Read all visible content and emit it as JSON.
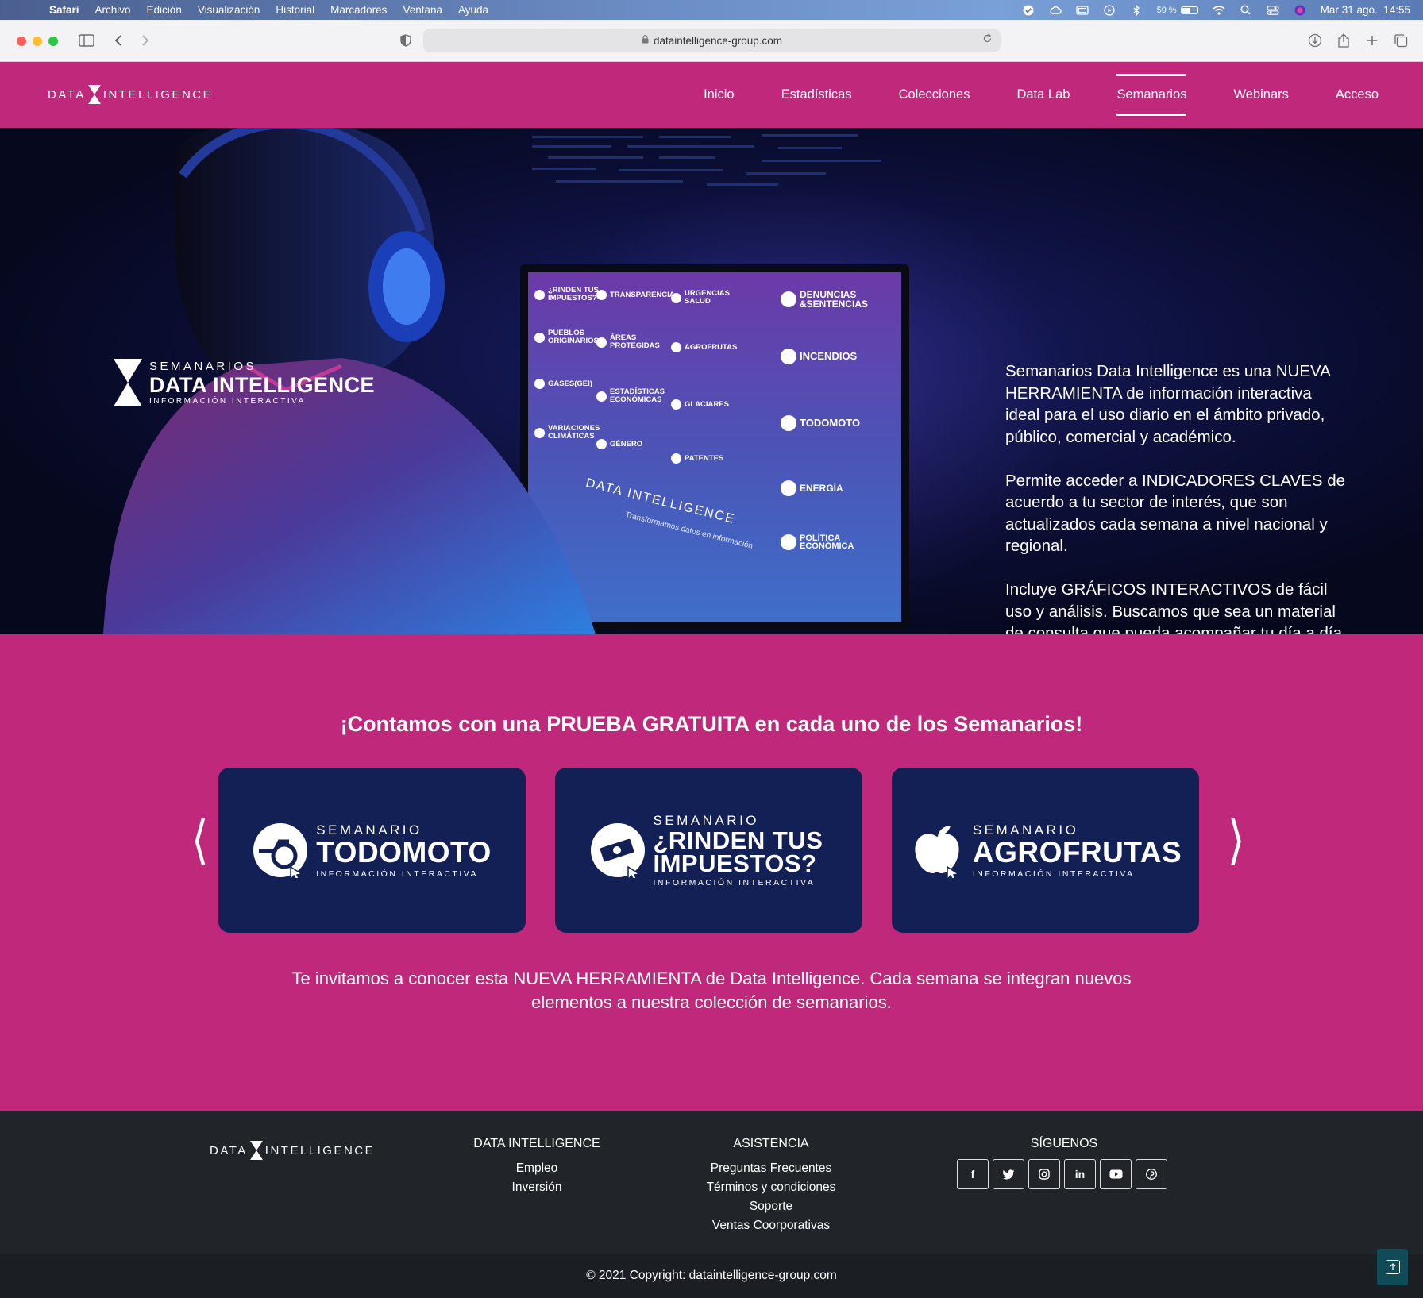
{
  "menubar": {
    "app": "Safari",
    "items": [
      "Archivo",
      "Edición",
      "Visualización",
      "Historial",
      "Marcadores",
      "Ventana",
      "Ayuda"
    ],
    "battery": "59 %",
    "battery_level": 0.59,
    "datetime": "Mar 31 ago.  14:55"
  },
  "browser": {
    "url": "dataintelligence-group.com"
  },
  "header": {
    "logo_left": "DATA",
    "logo_right": "INTELLIGENCE",
    "nav": [
      "Inicio",
      "Estadísticas",
      "Colecciones",
      "Data Lab",
      "Semanarios",
      "Webinars",
      "Acceso"
    ],
    "active_nav": "Semanarios"
  },
  "hero": {
    "logo": {
      "top": "SEMANARIOS",
      "main": "DATA INTELLIGENCE",
      "sub": "INFORMACIÓN INTERACTIVA"
    },
    "paragraphs": [
      "Semanarios Data Intelligence es una NUEVA HERRAMIENTA de información interactiva ideal para el uso diario en el ámbito privado, público, comercial y académico.",
      "Permite acceder a INDICADORES CLAVES de acuerdo a tu sector de interés, que son actualizados cada semana a nivel nacional y regional.",
      "Incluye GRÁFICOS INTERACTIVOS de fácil uso y análisis. Buscamos que sea un material de consulta que pueda acompañar tu día a día."
    ],
    "screen_items": [
      "¿RINDEN TUS IMPUESTOS?",
      "TRANSPARENCIA",
      "URGENCIAS SALUD",
      "DENUNCIAS &SENTENCIAS",
      "PUEBLOS ORIGINARIOS",
      "ÁREAS PROTEGIDAS",
      "AGROFRUTAS",
      "INCENDIOS",
      "GASES(GEI)",
      "ESTADÍSTICAS ECONÓMICAS",
      "GLACIARES",
      "TODOMOTO",
      "VARIACIONES CLIMÁTICAS",
      "GÉNERO",
      "PATENTES",
      "ENERGÍA",
      "POLÍTICA ECONÓMICA"
    ],
    "screen_brand": "DATA INTELLIGENCE",
    "screen_tagline": "Transformamos datos en información"
  },
  "trial": {
    "title": "¡Contamos con una PRUEBA GRATUITA en cada uno de los Semanarios!",
    "cards": [
      {
        "top": "SEMANARIO",
        "name": "TODOMOTO",
        "sub": "INFORMACIÓN INTERACTIVA"
      },
      {
        "top": "SEMANARIO",
        "name": "¿RINDEN TUS IMPUESTOS?",
        "sub": "INFORMACIÓN INTERACTIVA"
      },
      {
        "top": "SEMANARIO",
        "name": "AGROFRUTAS",
        "sub": "INFORMACIÓN INTERACTIVA"
      }
    ],
    "prev": "❬",
    "next": "❭",
    "invite": "Te invitamos a conocer esta NUEVA HERRAMIENTA de Data Intelligence. Cada semana se integran nuevos elementos a nuestra colección de semanarios."
  },
  "footer": {
    "logo_left": "DATA",
    "logo_right": "INTELLIGENCE",
    "col1": {
      "title": "DATA INTELLIGENCE",
      "links": [
        "Empleo",
        "Inversión"
      ]
    },
    "col2": {
      "title": "ASISTENCIA",
      "links": [
        "Preguntas Frecuentes",
        "Términos y condiciones",
        "Soporte",
        "Ventas Coorporativas"
      ]
    },
    "col3": {
      "title": "SÍGUENOS",
      "social": [
        "f",
        "t",
        "◎",
        "in",
        "▶",
        "P"
      ]
    },
    "copyright_prefix": "© 2021 Copyright: ",
    "copyright_link": "dataintelligence-group.com"
  },
  "colors": {
    "brand": "#c0287b",
    "card": "#132055",
    "footer": "#212529"
  }
}
